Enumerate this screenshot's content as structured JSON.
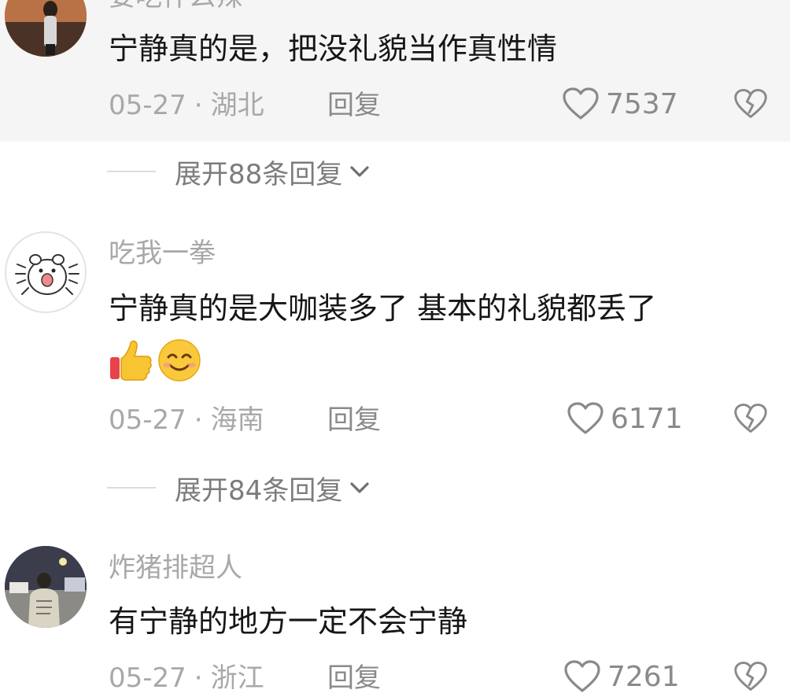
{
  "comments": [
    {
      "username": "要吃什么辣",
      "content": "宁静真的是，把没礼貌当作真性情",
      "date": "05-27",
      "location": "湖北",
      "reply_label": "回复",
      "likes": "7537",
      "expand_label": "展开88条回复"
    },
    {
      "username": "吃我一拳",
      "content": "宁静真的是大咖装多了 基本的礼貌都丢了",
      "emojis": [
        "thumbs-up-icon",
        "smile-icon"
      ],
      "date": "05-27",
      "location": "海南",
      "reply_label": "回复",
      "likes": "6171",
      "expand_label": "展开84条回复"
    },
    {
      "username": "炸猪排超人",
      "content": "有宁静的地方一定不会宁静",
      "date": "05-27",
      "location": "浙江",
      "reply_label": "回复",
      "likes": "7261"
    }
  ],
  "separator": "·",
  "colors": {
    "highlight_bg": "#f5f5f5",
    "text_primary": "#161616",
    "text_secondary": "#a8a8a8",
    "icon": "#8a8a8a"
  }
}
